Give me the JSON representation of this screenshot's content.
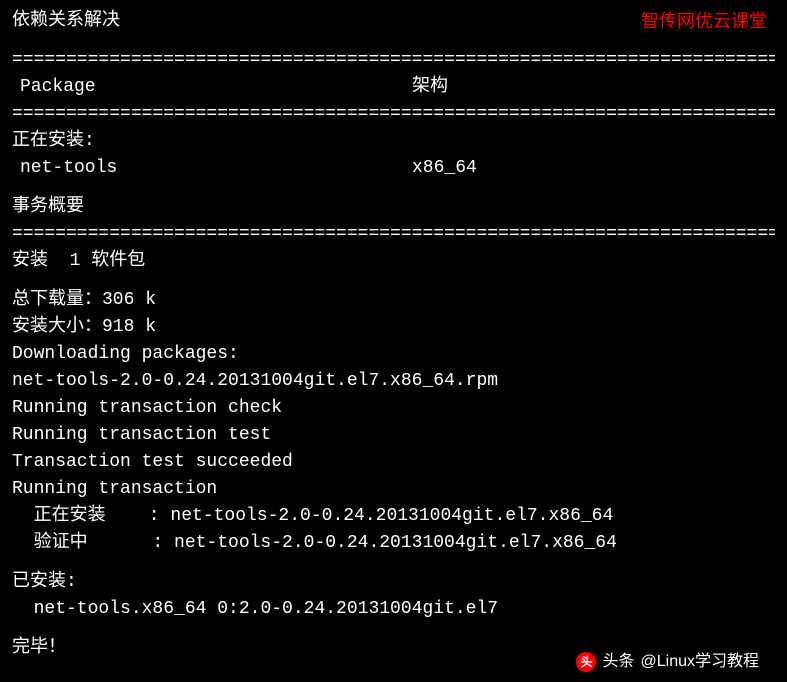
{
  "watermark": "智传网优云课堂",
  "dependency_resolved": "依赖关系解决",
  "separator": "====================================================================================",
  "header": {
    "package": "Package",
    "arch": "架构"
  },
  "installing_label": "正在安装:",
  "package_row": {
    "name": "net-tools",
    "arch": "x86_64"
  },
  "transaction_summary": "事务概要",
  "install_count": "安装  1 软件包",
  "total_download": "总下载量：306 k",
  "install_size": "安装大小：918 k",
  "downloading": "Downloading packages:",
  "rpm_file": "net-tools-2.0-0.24.20131004git.el7.x86_64.rpm",
  "running_check": "Running transaction check",
  "running_test": "Running transaction test",
  "test_succeeded": "Transaction test succeeded",
  "running_transaction": "Running transaction",
  "installing_step": "  正在安装    : net-tools-2.0-0.24.20131004git.el7.x86_64",
  "verifying_step": "  验证中      : net-tools-2.0-0.24.20131004git.el7.x86_64",
  "installed_label": "已安装:",
  "installed_package": "  net-tools.x86_64 0:2.0-0.24.20131004git.el7",
  "complete": "完毕！",
  "footer": {
    "badge": "头",
    "label": "头条",
    "source": "@Linux学习教程"
  }
}
